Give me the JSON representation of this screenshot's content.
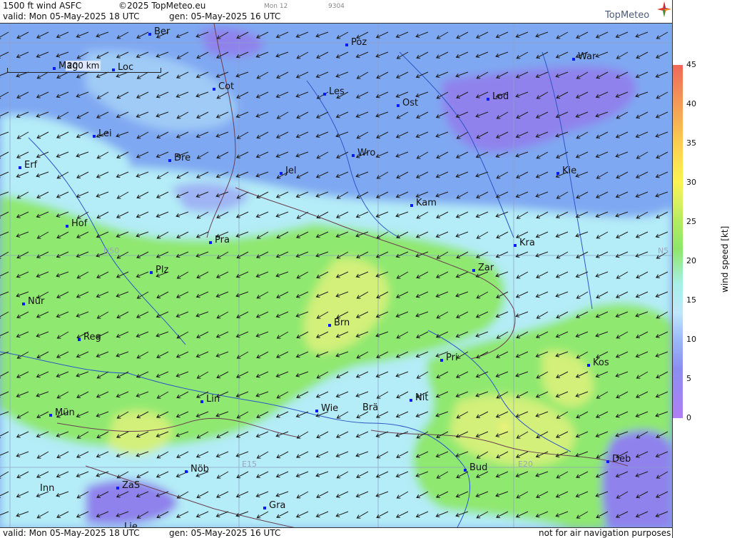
{
  "header": {
    "product": "1500 ft wind ASFC",
    "copyright": "©2025 TopMeteo.eu",
    "mark_mon": "Mon 12",
    "mark_code": "9304",
    "valid": "valid:  Mon  05-May-2025  18 UTC",
    "gen": "gen: 05-May-2025 16 UTC",
    "brand": "TopMeteo"
  },
  "map": {
    "scale_label": "200 km",
    "grid_labels": [
      {
        "text": "N50"
      },
      {
        "text": "N5"
      },
      {
        "text": "E15"
      },
      {
        "text": "E20"
      }
    ],
    "cities": [
      "Ber",
      "Poz",
      "War",
      "Mag",
      "Loc",
      "Cot",
      "Les",
      "Ost",
      "Lod",
      "Lei",
      "Dre",
      "Wro",
      "Jel",
      "Kie",
      "Erf",
      "Kam",
      "Hof",
      "Pra",
      "Kra",
      "Plz",
      "Zar",
      "Nür",
      "Brn",
      "Reg",
      "Pri",
      "Kos",
      "Lin",
      "Nit",
      "Wie",
      "Brä",
      "Mün",
      "Nöb",
      "Bud",
      "Deb",
      "Inn",
      "ZaS",
      "Gra",
      "Lie"
    ]
  },
  "legend": {
    "title": "wind speed [kt]",
    "ticks": [
      "45",
      "40",
      "35",
      "30",
      "25",
      "20",
      "15",
      "10",
      "5",
      "0"
    ]
  },
  "footer": {
    "valid": "valid:  Mon  05-May-2025  18 UTC",
    "gen": "gen: 05-May-2025 16 UTC",
    "disclaimer": "not for air navigation purposes"
  },
  "colors": {
    "purple": "#8f82ec",
    "blue": "#7fa8f2",
    "cyan": "#b4ecf7",
    "green": "#8fe870",
    "yellowgreen": "#d2f07a",
    "yellow": "#f4f27a"
  }
}
